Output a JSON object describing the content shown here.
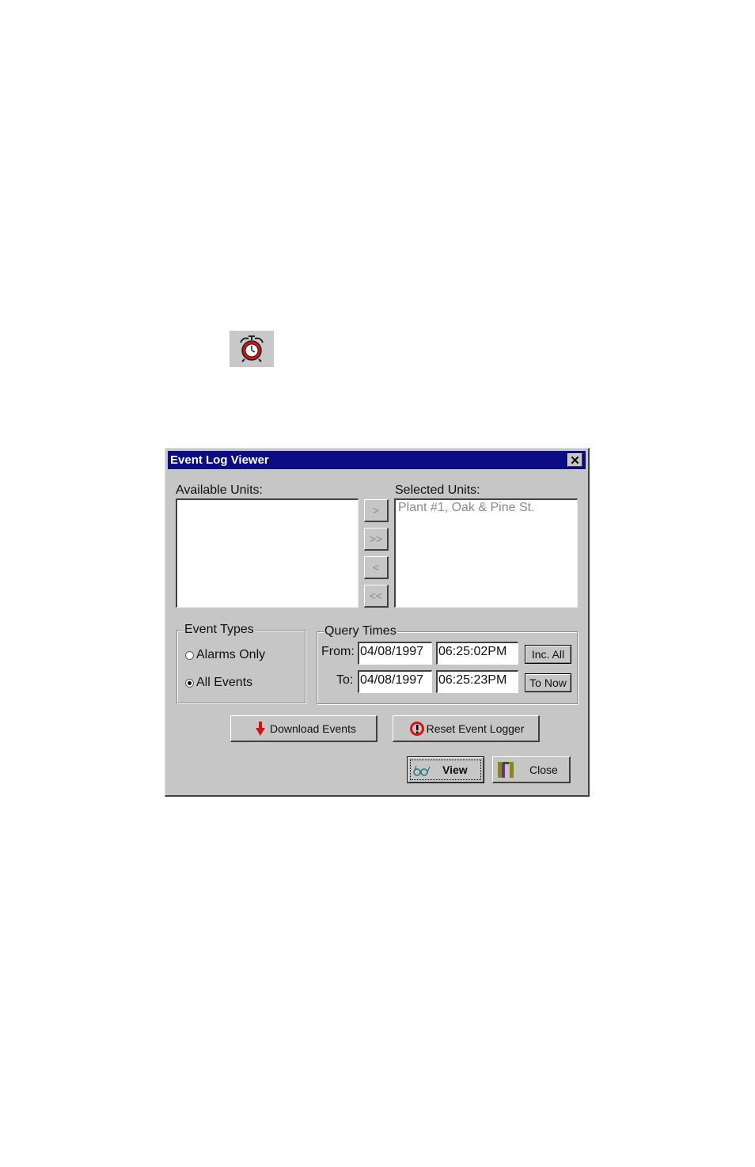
{
  "app_icon": {
    "icon": "alarm-clock-icon",
    "color": "#c81818"
  },
  "dialog": {
    "title": "Event Log Viewer",
    "title_bar_color": "#0c0c84",
    "close_label": "✕",
    "available_units": {
      "label": "Available Units:",
      "items": []
    },
    "selected_units": {
      "label": "Selected Units:",
      "items": [
        "Plant #1, Oak & Pine St."
      ]
    },
    "move_buttons": [
      {
        "label": ">",
        "name": "add-one-button"
      },
      {
        "label": ">>",
        "name": "add-all-button"
      },
      {
        "label": "<",
        "name": "remove-one-button"
      },
      {
        "label": "<<",
        "name": "remove-all-button"
      }
    ],
    "event_types": {
      "legend": "Event Types",
      "options": [
        {
          "label": "Alarms Only",
          "selected": false
        },
        {
          "label": "All Events",
          "selected": true
        }
      ]
    },
    "query_times": {
      "legend": "Query Times",
      "from_label": "From:",
      "from_date": "04/08/1997",
      "from_time": "06:25:02PM",
      "to_label": "To:",
      "to_date": "04/08/1997",
      "to_time": "06:25:23PM",
      "inc_all_label": "Inc. All",
      "to_now_label": "To Now"
    },
    "buttons": {
      "download": "Download Events",
      "reset": "Reset Event Logger",
      "view": "View",
      "close": "Close"
    }
  }
}
